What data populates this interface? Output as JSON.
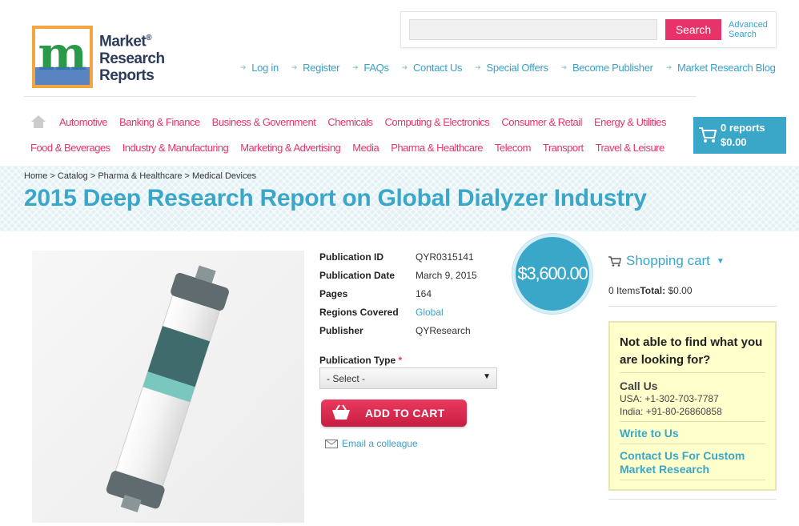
{
  "logo": {
    "line1": "Market",
    "line2": "Research",
    "line3": "Reports",
    "reg": "®"
  },
  "search": {
    "placeholder": "",
    "button": "Search",
    "advanced": "Advanced Search"
  },
  "top_links": [
    "Log in",
    "Register",
    "FAQs",
    "Contact Us",
    "Special Offers",
    "Become Publisher",
    "Market Research Blog"
  ],
  "nav_row1": [
    "Automotive",
    "Banking & Finance",
    "Business & Government",
    "Chemicals",
    "Computing & Electronics",
    "Consumer & Retail",
    "Energy & Utilities"
  ],
  "nav_row2": [
    "Food & Beverages",
    "Industry & Manufacturing",
    "Marketing & Advertising",
    "Media",
    "Pharma & Healthcare",
    "Telecom",
    "Transport",
    "Travel & Leisure"
  ],
  "cart": {
    "reports": "0 reports",
    "total": "$0.00"
  },
  "breadcrumb": "Home > Catalog > Pharma & Healthcare > Medical Devices",
  "title": "2015 Deep Research Report on Global Dialyzer Industry",
  "details": [
    {
      "label": "Publication ID",
      "value": "QYR0315141"
    },
    {
      "label": "Publication Date",
      "value": "March 9, 2015"
    },
    {
      "label": "Pages",
      "value": "164"
    },
    {
      "label": "Regions Covered",
      "value": "Global"
    },
    {
      "label": "Publisher",
      "value": "QYResearch"
    }
  ],
  "publication_type": {
    "label": "Publication Type",
    "required": "*",
    "selected": "- Select -"
  },
  "add_to_cart": "ADD TO CART",
  "email_colleague": "Email a colleague",
  "price": "$3,600.00",
  "shopping_cart": {
    "title": "Shopping cart",
    "items": "0 Items",
    "total_label": "Total:",
    "total": "$0.00"
  },
  "help": {
    "question": "Not able to find what you are looking for?",
    "call_us": "Call Us",
    "usa": "USA: +1-302-703-7787",
    "india": "India: +91-80-26860858",
    "write": "Write to Us",
    "custom": "Contact Us For Custom Market Research"
  },
  "colors": {
    "accent": "#3aa6c8",
    "pink": "#e8336a",
    "help_bg": "#ffffcc"
  }
}
